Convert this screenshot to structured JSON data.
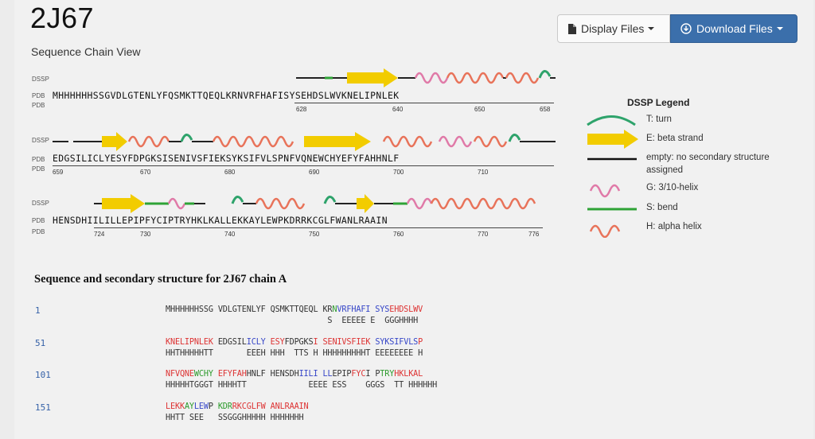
{
  "page": {
    "title": "2J67",
    "subtitle": "Sequence Chain View"
  },
  "toolbar": {
    "display_label": "Display Files",
    "download_label": "Download Files"
  },
  "colors": {
    "beta_strand": "#f2cc00",
    "alpha_helix": "#e8735a",
    "helix_3_10": "#e07aa8",
    "turn": "#2ea36b",
    "bend": "#2ea336",
    "primary_button": "#3b6fab"
  },
  "sequence_view": {
    "row_labels": {
      "dssp": "DSSP",
      "pdb": "PDB"
    },
    "rows": [
      {
        "sequence": "MHHHHHHSSGVDLGTENLYFQSMKTTQEQLKRNVRFHAFISYSEHDSLWVKNELIPNLEK",
        "ticks": [
          "628",
          "640",
          "650",
          "658"
        ]
      },
      {
        "sequence": "EDGSILICLYESYFDPGKSISENIVSFIEKSYKSIFVLSPNFVQNEWCHYEFYFAHHNLF",
        "ticks": [
          "659",
          "670",
          "680",
          "690",
          "700",
          "710"
        ]
      },
      {
        "sequence": "HENSDHIILILLEPIPFYCIPTRYHKLKALLEKKAYLEWPKDRRKCGLFWANLRAAIN",
        "ticks": [
          "724",
          "730",
          "740",
          "750",
          "760",
          "770",
          "776"
        ]
      }
    ]
  },
  "legend": {
    "title": "DSSP Legend",
    "items": [
      {
        "icon": "turn-icon",
        "label": "T: turn"
      },
      {
        "icon": "beta-strand-icon",
        "label": "E: beta strand"
      },
      {
        "icon": "coil-icon",
        "label": "empty: no secondary structure assigned"
      },
      {
        "icon": "helix-310-icon",
        "label": "G: 3/10-helix"
      },
      {
        "icon": "bend-icon",
        "label": "S: bend"
      },
      {
        "icon": "alpha-helix-icon",
        "label": "H: alpha helix"
      }
    ]
  },
  "secondary_structure": {
    "header": "Sequence and secondary structure for 2J67 chain A",
    "blocks": [
      {
        "number": "1",
        "residues": "MHHHHHHSSG VDLGTENLYF QSMKTTQEQL KRNVRFHAFI SYSEHDSLWV",
        "structure": "                                  S  EEEEE E  GGGHHHH"
      },
      {
        "number": "51",
        "residues": "KNELIPNLEK EDGSILICLY ESYFDPGKSI SENIVSFIEK SYKSIFVLSP",
        "structure": "HHTHHHHHTT       EEEH HHH  TTS H HHHHHHHHHT EEEEEEEE H"
      },
      {
        "number": "101",
        "residues": "NFVQNEWCHY EFYFAHHNLF HENSDHIILI LLEPIPFYCI PTRYHKLKAL",
        "structure": "HHHHHTGGGT HHHHTT             EEEE ESS    GGGS  TT HHHHHH"
      },
      {
        "number": "151",
        "residues": "LEKKAYLEWP KDRRKCGLFW ANLRAAIN",
        "structure": "HHTT SEE   SSGGGHHHHH HHHHHHH"
      }
    ]
  }
}
